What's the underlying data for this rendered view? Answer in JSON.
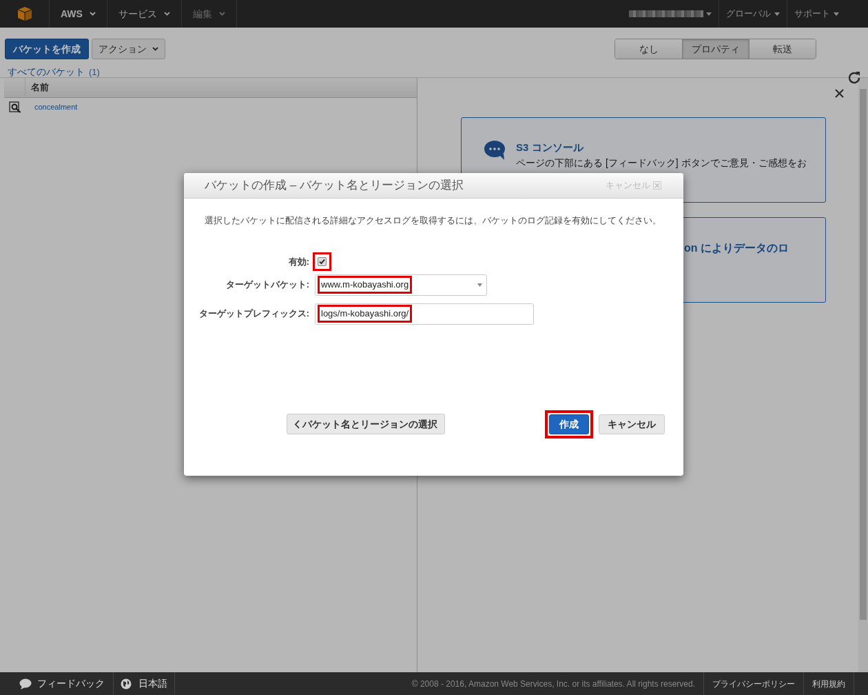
{
  "top_nav": {
    "menus": [
      {
        "label": "AWS"
      },
      {
        "label": "サービス"
      },
      {
        "label": "編集"
      }
    ],
    "right_menus": [
      {
        "label": "グローバル"
      },
      {
        "label": "サポート"
      }
    ]
  },
  "toolbar": {
    "create_button": "バケットを作成",
    "actions_button": "アクション",
    "view_tabs": [
      {
        "label": "なし",
        "selected": false
      },
      {
        "label": "プロパティ",
        "selected": true
      },
      {
        "label": "転送",
        "selected": false
      }
    ]
  },
  "bucket_list": {
    "title": "すべてのバケット",
    "count": "(1)",
    "columns": [
      "名前"
    ],
    "rows": [
      {
        "name": "concealment"
      }
    ]
  },
  "info_cards": [
    {
      "title": "S3 コンソール",
      "text": "ページの下部にある [フィードバック] ボタンでご意見・ご感想をお"
    },
    {
      "text": "on によりデータのロ"
    }
  ],
  "dialog": {
    "title": "バケットの作成 – バケット名とリージョンの選択",
    "close_label": "キャンセル",
    "description": "選択したバケットに配信される詳細なアクセスログを取得するには、バケットのログ記録を有効にしてください。",
    "fields": [
      {
        "kind": "checkbox",
        "label": "有効:",
        "checked": true,
        "highlighted": true
      },
      {
        "kind": "select",
        "label": "ターゲットバケット:",
        "value": "www.m-kobayashi.org",
        "highlighted": true
      },
      {
        "kind": "text",
        "label": "ターゲットプレフィックス:",
        "value": "logs/m-kobayashi.org/",
        "highlighted": true
      }
    ],
    "buttons": [
      {
        "kind": "back",
        "label": "バケット名とリージョンの選択"
      },
      {
        "kind": "primary",
        "label": "作成",
        "highlighted": true
      },
      {
        "kind": "secondary",
        "label": "キャンセル"
      }
    ]
  },
  "footer": {
    "feedback": "フィードバック",
    "language": "日本語",
    "copyright": "© 2008 - 2016, Amazon Web Services, Inc. or its affiliates. All rights reserved.",
    "links": [
      "プライバシーポリシー",
      "利用規約"
    ]
  }
}
